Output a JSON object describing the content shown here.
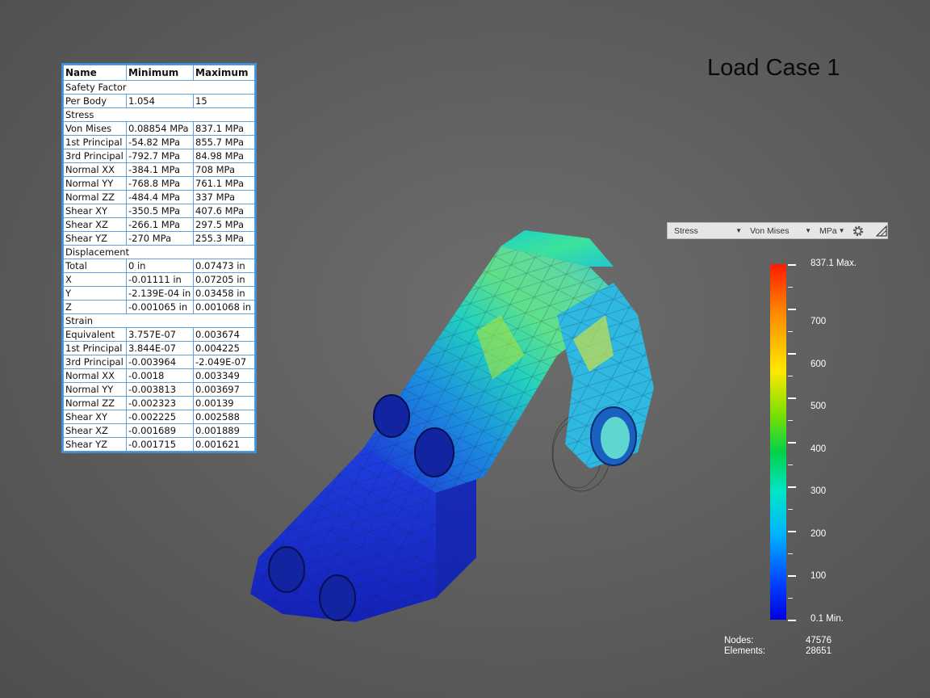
{
  "title": "Load Case 1",
  "table": {
    "headers": [
      "Name",
      "Minimum",
      "Maximum"
    ],
    "rows": [
      {
        "section": "Safety Factor"
      },
      {
        "name": "Per Body",
        "min": "1.054",
        "max": "15"
      },
      {
        "section": "Stress"
      },
      {
        "name": "Von Mises",
        "min": "0.08854 MPa",
        "max": "837.1 MPa"
      },
      {
        "name": "1st Principal",
        "min": "-54.82 MPa",
        "max": "855.7 MPa"
      },
      {
        "name": "3rd Principal",
        "min": "-792.7 MPa",
        "max": "84.98 MPa"
      },
      {
        "name": "Normal XX",
        "min": "-384.1 MPa",
        "max": "708 MPa"
      },
      {
        "name": "Normal YY",
        "min": "-768.8 MPa",
        "max": "761.1 MPa"
      },
      {
        "name": "Normal ZZ",
        "min": "-484.4 MPa",
        "max": "337 MPa"
      },
      {
        "name": "Shear XY",
        "min": "-350.5 MPa",
        "max": "407.6 MPa"
      },
      {
        "name": "Shear XZ",
        "min": "-266.1 MPa",
        "max": "297.5 MPa"
      },
      {
        "name": "Shear YZ",
        "min": "-270 MPa",
        "max": "255.3 MPa"
      },
      {
        "section": "Displacement"
      },
      {
        "name": "Total",
        "min": "0 in",
        "max": "0.07473 in"
      },
      {
        "name": "X",
        "min": "-0.01111 in",
        "max": "0.07205 in"
      },
      {
        "name": "Y",
        "min": "-2.139E-04 in",
        "max": "0.03458 in"
      },
      {
        "name": "Z",
        "min": "-0.001065 in",
        "max": "0.001068 in"
      },
      {
        "section": "Strain"
      },
      {
        "name": "Equivalent",
        "min": "3.757E-07",
        "max": "0.003674"
      },
      {
        "name": "1st Principal",
        "min": "3.844E-07",
        "max": "0.004225"
      },
      {
        "name": "3rd Principal",
        "min": "-0.003964",
        "max": "-2.049E-07"
      },
      {
        "name": "Normal XX",
        "min": "-0.0018",
        "max": "0.003349"
      },
      {
        "name": "Normal YY",
        "min": "-0.003813",
        "max": "0.003697"
      },
      {
        "name": "Normal ZZ",
        "min": "-0.002323",
        "max": "0.00139"
      },
      {
        "name": "Shear XY",
        "min": "-0.002225",
        "max": "0.002588"
      },
      {
        "name": "Shear XZ",
        "min": "-0.001689",
        "max": "0.001889"
      },
      {
        "name": "Shear YZ",
        "min": "-0.001715",
        "max": "0.001621"
      }
    ]
  },
  "toolbar": {
    "result_type": "Stress",
    "component": "Von Mises",
    "unit": "MPa",
    "icons": [
      "settings-gear-icon",
      "plot-options-icon"
    ]
  },
  "legend": {
    "max_label": "837.1 Max.",
    "min_label": "0.1 Min.",
    "ticks": [
      "700",
      "600",
      "500",
      "400",
      "300",
      "200",
      "100"
    ],
    "colors": [
      "#ff1a00",
      "#ff8c00",
      "#ffe800",
      "#7ee000",
      "#00d24a",
      "#00e6c8",
      "#00b4ff",
      "#0040ff",
      "#0000e0"
    ]
  },
  "mesh_info": {
    "nodes_label": "Nodes:",
    "nodes_value": "47576",
    "elements_label": "Elements:",
    "elements_value": "28651"
  }
}
